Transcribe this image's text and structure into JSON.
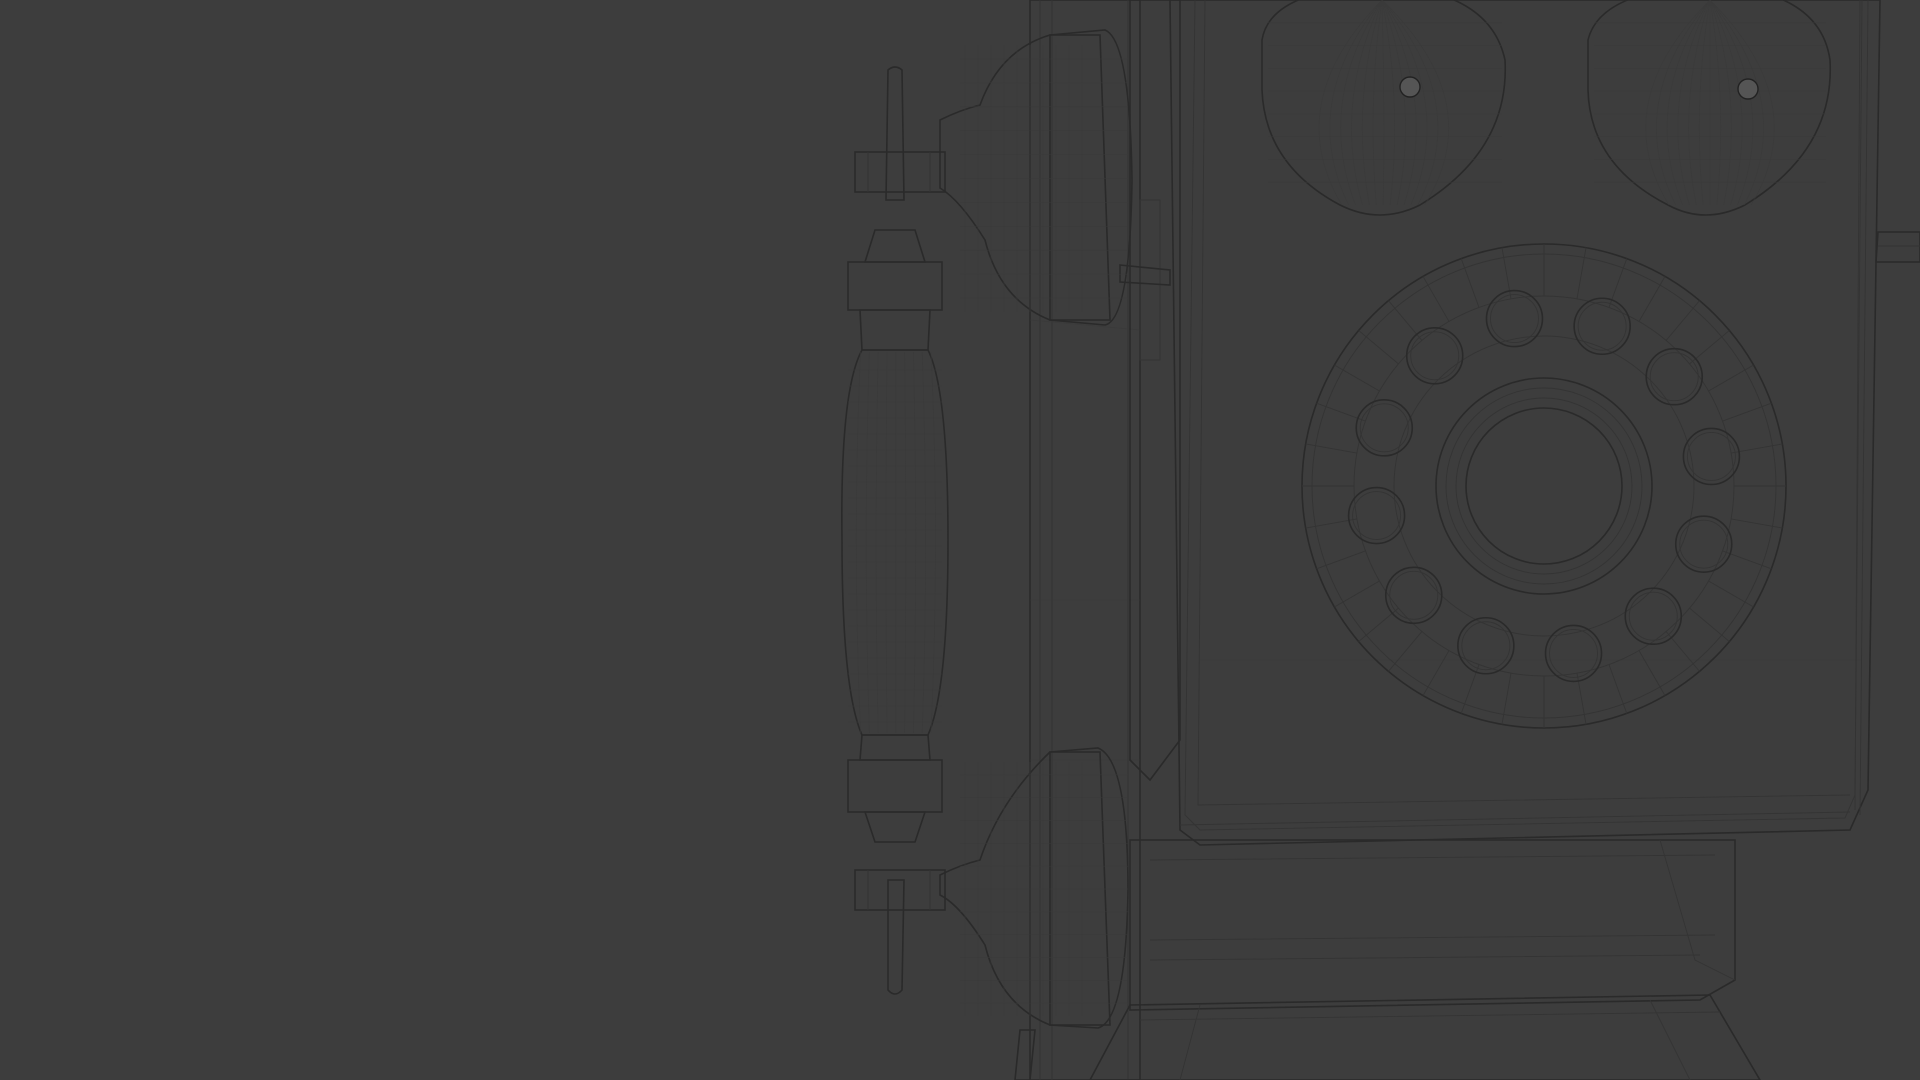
{
  "scene": {
    "background_color": "#3d3d3d",
    "model_color": "#9c9c9c",
    "wire_color": "#2e2e2e",
    "objects": [
      "wall-phone-body",
      "handset",
      "bell-dome-left",
      "bell-dome-right",
      "rotary-dial",
      "shelf"
    ],
    "dial_finger_holes": 12
  }
}
